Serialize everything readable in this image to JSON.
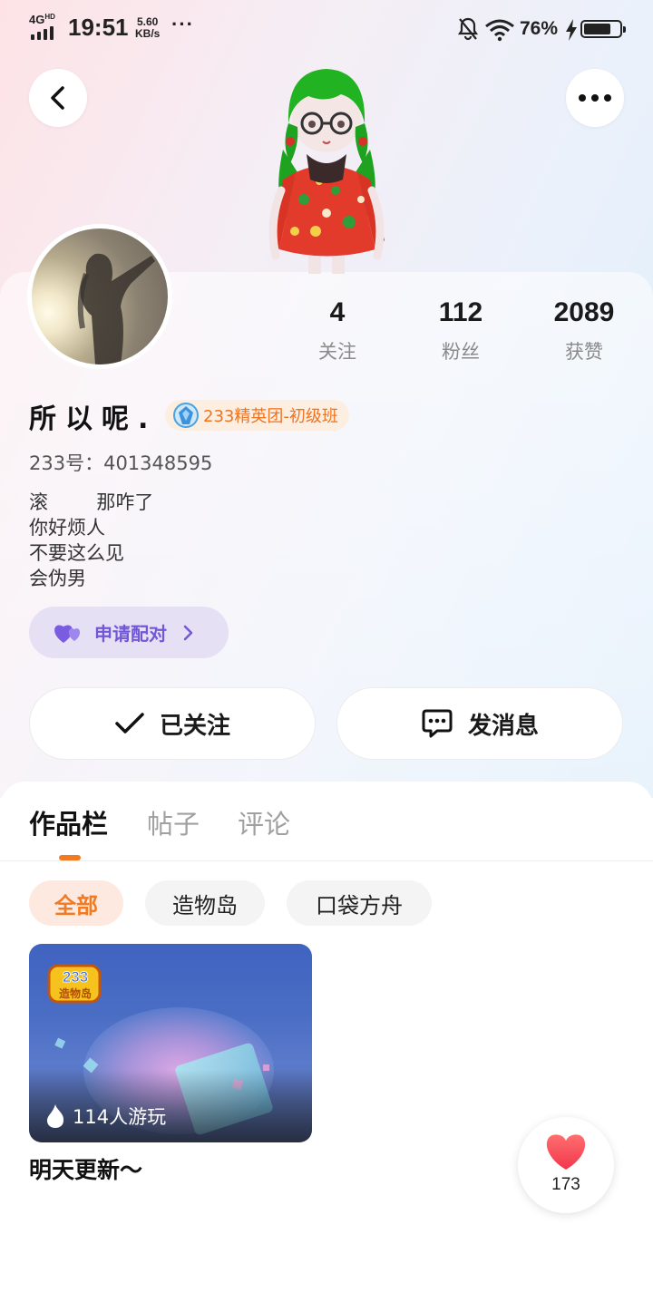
{
  "status_bar": {
    "network": "4G",
    "network_sup": "HD",
    "time": "19:51",
    "speed_value": "5.60",
    "speed_unit": "KB/s",
    "more": "···",
    "battery_percent_text": "76%",
    "battery_level": 0.76
  },
  "header": {
    "back_icon": "chevron-left-icon",
    "more_icon": "more-horizontal-icon"
  },
  "profile": {
    "stats": [
      {
        "value": "4",
        "label": "关注"
      },
      {
        "value": "112",
        "label": "粉丝"
      },
      {
        "value": "2089",
        "label": "获赞"
      }
    ],
    "username": "所以呢.",
    "badge": "233精英团-初级班",
    "uid": "233号：401348595",
    "bio": "滚        那咋了\n你好烦人\n不要这么见\n会伪男",
    "pair_button": "申请配对",
    "follow_button": "已关注",
    "message_button": "发消息"
  },
  "tabs": [
    {
      "label": "作品栏",
      "active": true
    },
    {
      "label": "帖子",
      "active": false
    },
    {
      "label": "评论",
      "active": false
    }
  ],
  "filters": [
    {
      "label": "全部",
      "active": true
    },
    {
      "label": "造物岛",
      "active": false
    },
    {
      "label": "口袋方舟",
      "active": false
    }
  ],
  "works": [
    {
      "logo_text": "233造物岛",
      "plays": "114人游玩",
      "title": "明天更新～"
    }
  ],
  "like_fab": {
    "count": "173"
  },
  "colors": {
    "accent_orange": "#f27a21",
    "pair_purple": "#7257d8",
    "heart_red": "#ff4d5e"
  }
}
